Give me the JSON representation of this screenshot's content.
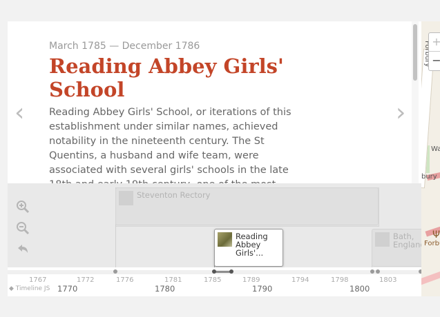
{
  "slide": {
    "date": "March 1785 — December 1786",
    "headline": "Reading Abbey Girls' School",
    "body": "Reading Abbey Girls' School, or iterations of this establishment under similar names, achieved notability in the nineteenth century. The St Quentins, a husband and wife team, were associated with several girls' schools in the late 18th and early 19th century, one of the most famous in Reading..."
  },
  "nav": {
    "prev_glyph": "‹",
    "next_glyph": "›"
  },
  "map": {
    "zoom_in": "+",
    "zoom_out": "−",
    "labels": {
      "vertical": "Forbury",
      "w": "Wa",
      "b": "bury",
      "f": "Forbu"
    }
  },
  "timeline": {
    "tools": {
      "zoom_in_icon": "magnifier-plus-icon",
      "zoom_out_icon": "magnifier-minus-icon",
      "back_icon": "back-arrow-icon"
    },
    "markers": {
      "steventon": "Steventon Rectory",
      "reading": "Reading Abbey Girls'...",
      "bath": "Bath, England"
    },
    "minor_years": [
      "1767",
      "1772",
      "1776",
      "1781",
      "1785",
      "1789",
      "1794",
      "1798",
      "1803"
    ],
    "major_years": [
      "1770",
      "1780",
      "1790",
      "1800"
    ],
    "credit": "Timeline JS"
  },
  "colors": {
    "headline": "#c34528",
    "text": "#666666",
    "date": "#999999"
  }
}
